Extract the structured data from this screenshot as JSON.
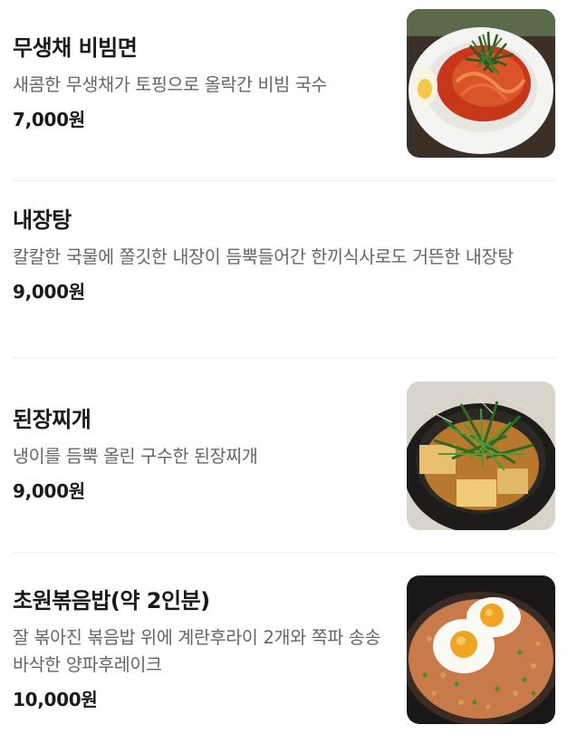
{
  "menu": {
    "items": [
      {
        "name": "무생채 비빔면",
        "description": "새콤한 무생채가 토핑으로 올락간 비빔 국수",
        "price": "7,000원",
        "image_icon": "bibim-noodles-photo"
      },
      {
        "name": "내장탕",
        "description": "칼칼한 국물에 쫄깃한 내장이 듬뿍들어간 한끼식사로도 거뜬한 내장탕",
        "price": "9,000원"
      },
      {
        "name": "된장찌개",
        "description": "냉이를 듬뿍 올린 구수한 된장찌개",
        "price": "9,000원",
        "image_icon": "doenjang-stew-photo"
      },
      {
        "name": "초원볶음밥(약 2인분)",
        "description": "잘 볶아진 볶음밥 위에 계란후라이 2개와 쪽파 송송 바삭한 양파후레이크",
        "price": "10,000원",
        "image_icon": "fried-rice-photo"
      }
    ]
  }
}
